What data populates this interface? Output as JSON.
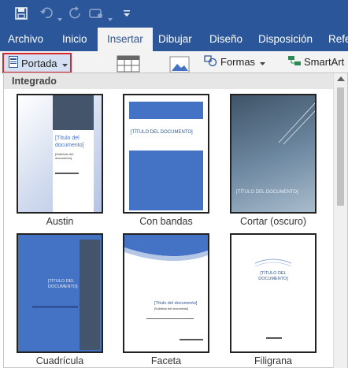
{
  "qat": {
    "icons": [
      "save-icon",
      "undo-icon",
      "redo-icon",
      "touch-mode-icon",
      "customize-icon"
    ]
  },
  "tabs": [
    "Archivo",
    "Inicio",
    "Insertar",
    "Dibujar",
    "Diseño",
    "Disposición",
    "Refe"
  ],
  "active_tab": "Insertar",
  "ribbon": {
    "portada_label": "Portada",
    "formas_label": "Formas",
    "smartart_label": "SmartArt"
  },
  "panel": {
    "section_title": "Integrado",
    "items": [
      {
        "label": "Austin",
        "title": "[Título del documento]",
        "subtitle": "[Subtítulo del documento]"
      },
      {
        "label": "Con bandas",
        "title": "[TÍTULO DEL DOCUMENTO]"
      },
      {
        "label": "Cortar (oscuro)",
        "title": "[TÍTULO DEL DOCUMENTO]"
      },
      {
        "label": "Cuadrícula",
        "title": "[TÍTULO DEL DOCUMENTO]"
      },
      {
        "label": "Faceta",
        "title": "[Título del documento]",
        "subtitle": "[Subtítulo del documento]"
      },
      {
        "label": "Filigrana",
        "title": "[TÍTULO DEL DOCUMENTO]"
      }
    ]
  },
  "colors": {
    "ribbon_blue": "#2b579a",
    "accent_blue": "#4472c4",
    "highlight_red": "#d9262c"
  }
}
